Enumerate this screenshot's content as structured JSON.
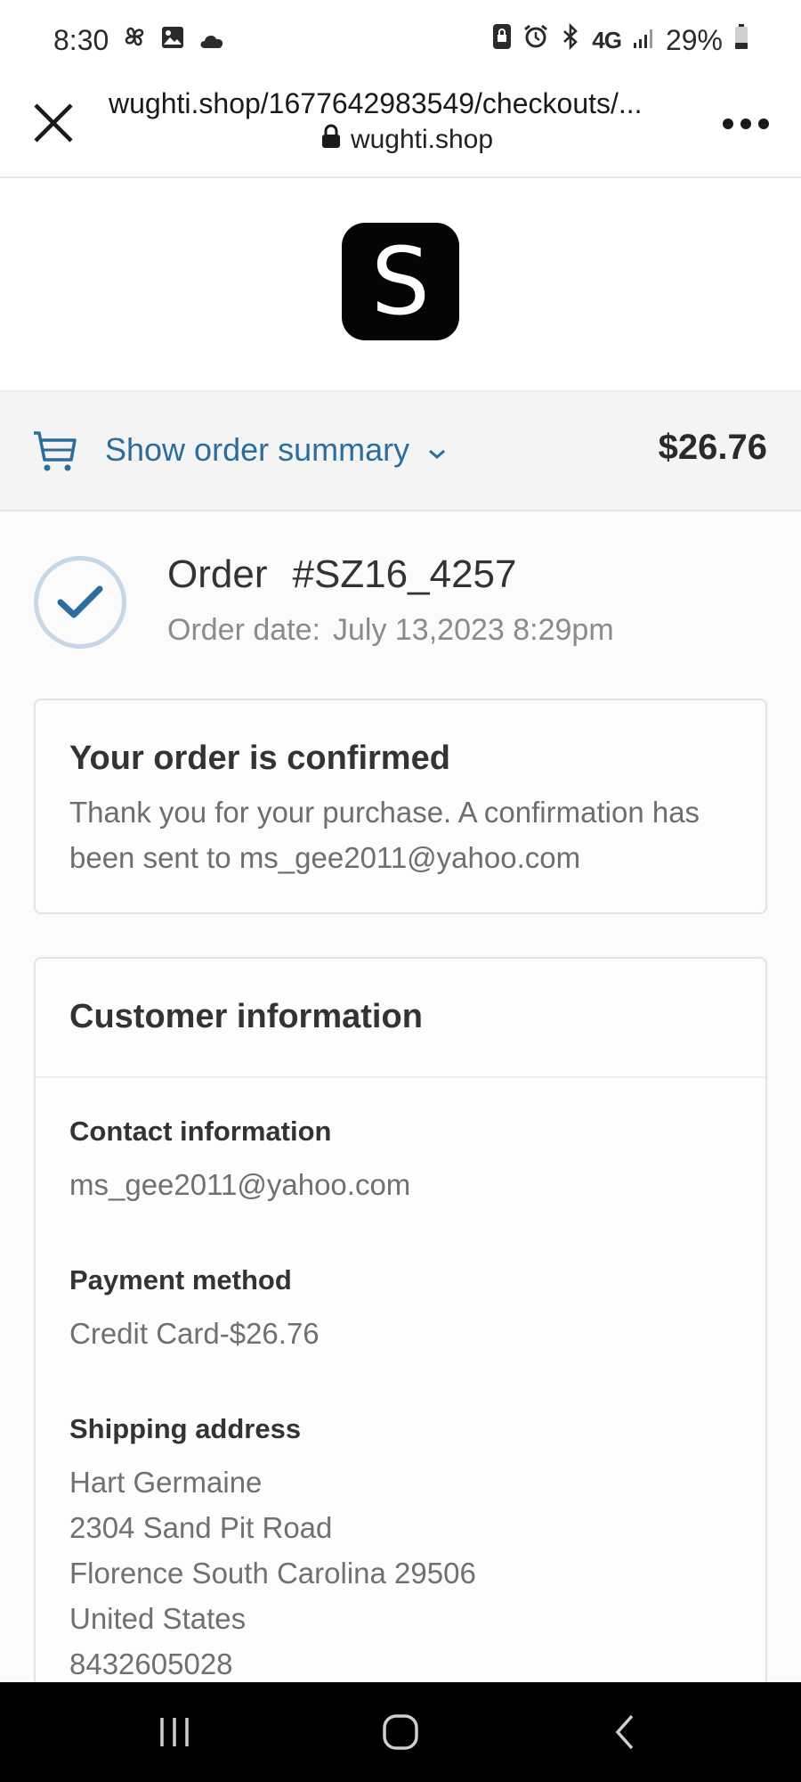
{
  "status_bar": {
    "time": "8:30",
    "network": "4G",
    "battery_percent": "29%",
    "battery_level": 0.29,
    "left_icons": [
      "pinwheel-icon",
      "image-icon",
      "cloud-icon"
    ],
    "right_icons": [
      "lock-screen-icon",
      "alarm-icon",
      "bluetooth-icon",
      "signal-icon",
      "battery-icon"
    ]
  },
  "browser": {
    "url": "wughti.shop/1677642983549/checkouts/...",
    "domain": "wughti.shop"
  },
  "logo": {
    "letter": "S"
  },
  "summary": {
    "toggle_label": "Show order summary",
    "total": "$26.76",
    "accent_color": "#2b6d9c"
  },
  "order": {
    "label": "Order",
    "number": "#SZ16_4257",
    "date_label": "Order date:",
    "date_value": "July 13,2023 8:29pm"
  },
  "confirmation": {
    "title": "Your order is confirmed",
    "message": "Thank you for your purchase. A confirmation has been sent to ms_gee2011@yahoo.com"
  },
  "customer_info": {
    "title": "Customer information",
    "contact_label": "Contact information",
    "contact_value": "ms_gee2011@yahoo.com",
    "payment_label": "Payment method",
    "payment_value": "Credit Card-$26.76",
    "shipping_label": "Shipping address",
    "shipping_lines": [
      "Hart Germaine",
      "2304 Sand Pit Road",
      "Florence South Carolina 29506",
      "United States",
      "8432605028"
    ]
  }
}
